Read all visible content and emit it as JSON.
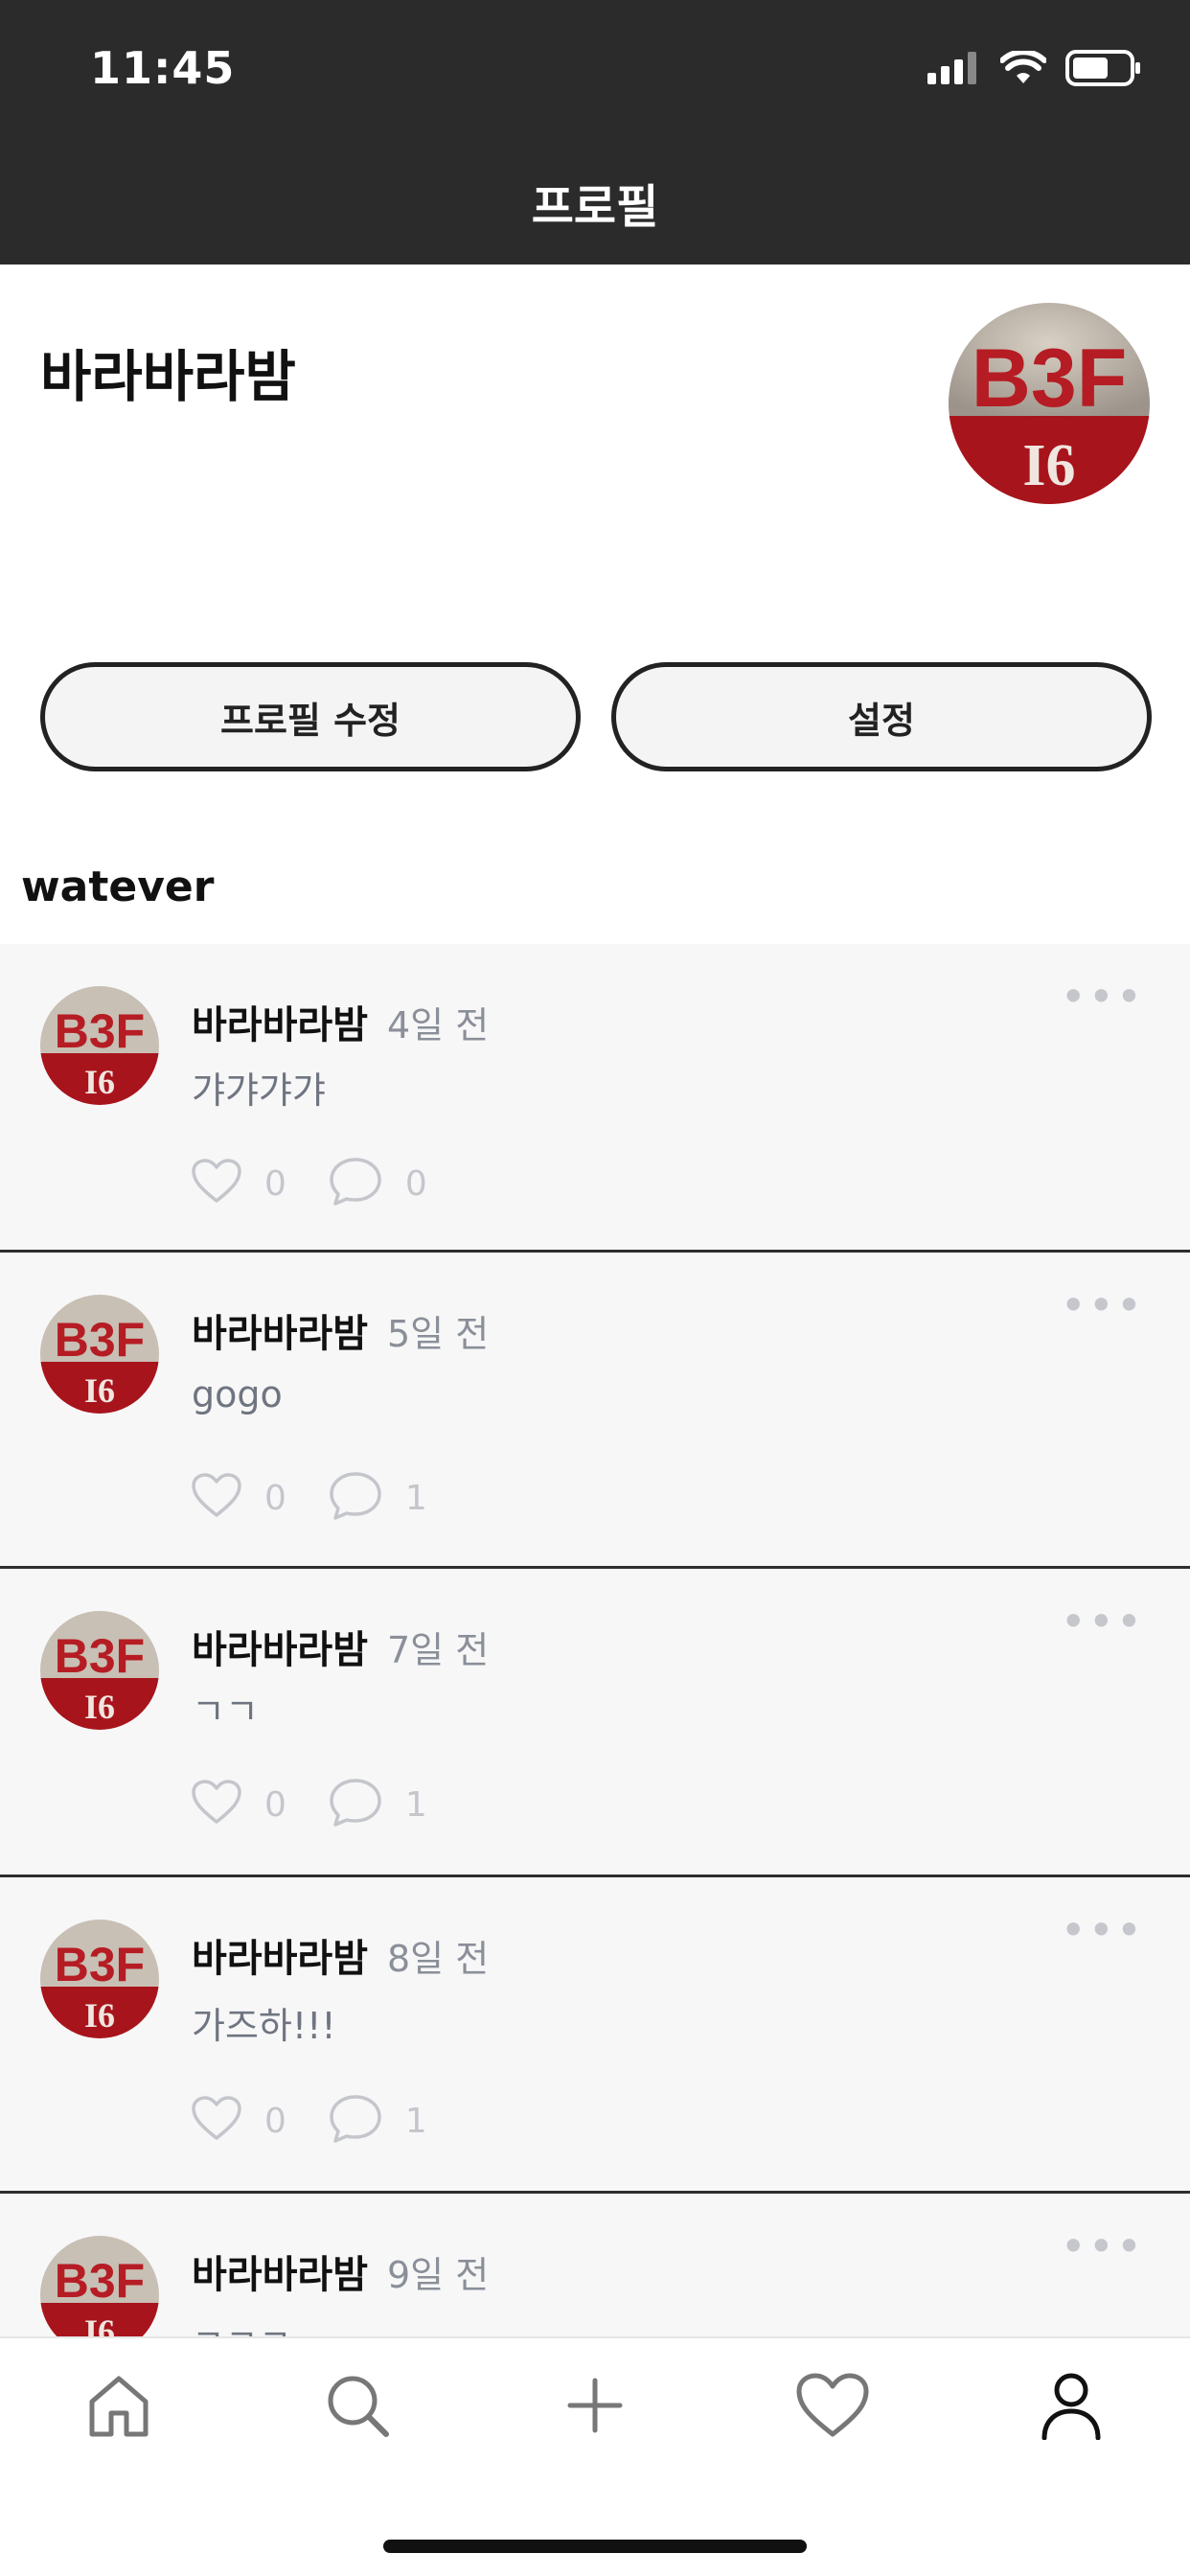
{
  "status_bar": {
    "time": "11:45"
  },
  "nav": {
    "title": "프로필"
  },
  "profile": {
    "name": "바라바라밤",
    "avatar_text_top": "B3F",
    "avatar_text_bottom": "I6",
    "edit_button": "프로필 수정",
    "settings_button": "설정",
    "section_title": "watever"
  },
  "posts": [
    {
      "author": "바라바라밤",
      "time": "4일 전",
      "content": "갸갸갸갸",
      "likes": "0",
      "comments": "0"
    },
    {
      "author": "바라바라밤",
      "time": "5일 전",
      "content": "gogo",
      "likes": "0",
      "comments": "1"
    },
    {
      "author": "바라바라밤",
      "time": "7일 전",
      "content": "ㄱㄱ",
      "likes": "0",
      "comments": "1"
    },
    {
      "author": "바라바라밤",
      "time": "8일 전",
      "content": "가즈하!!!",
      "likes": "0",
      "comments": "1"
    },
    {
      "author": "바라바라밤",
      "time": "9일 전",
      "content": "ㄱㄱㄱ",
      "likes": "",
      "comments": ""
    }
  ],
  "tabbar": {
    "items": [
      "home-icon",
      "search-icon",
      "plus-icon",
      "heart-icon",
      "person-icon"
    ]
  },
  "colors": {
    "topbar": "#2b2b2b",
    "feed_bg": "#f7f7f8",
    "muted": "#8a8f98",
    "accent_text": "#111111"
  }
}
